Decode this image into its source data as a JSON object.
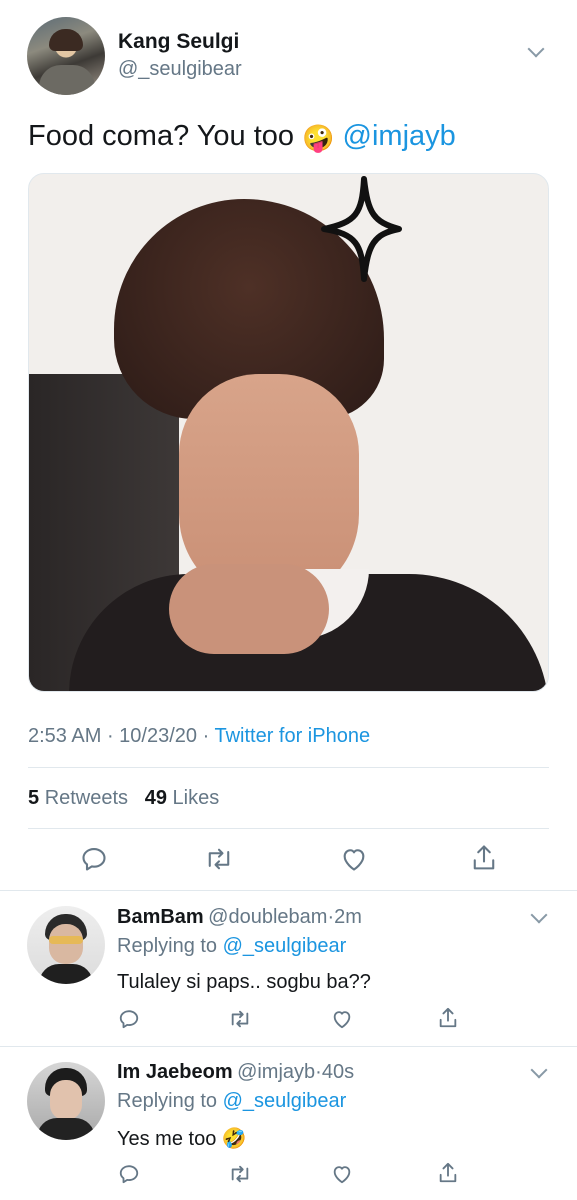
{
  "main_tweet": {
    "display_name": "Kang Seulgi",
    "handle": "@_seulgibear",
    "text": "Food coma? You too",
    "emoji": "🤪",
    "mention": "@imjayb",
    "time": "2:53 AM",
    "separator": " · ",
    "date": "10/23/20",
    "source": "Twitter for iPhone",
    "retweets_count": "5",
    "retweets_label": "Retweets",
    "likes_count": "49",
    "likes_label": "Likes"
  },
  "replies": [
    {
      "display_name": "BamBam",
      "handle": "@doublebam",
      "dot": "·",
      "time": "2m",
      "replying_prefix": "Replying to ",
      "replying_handle": "@_seulgibear",
      "text": "Tulaley si paps.. sogbu ba??"
    },
    {
      "display_name": "Im Jaebeom",
      "handle": "@imjayb",
      "dot": "·",
      "time": "40s",
      "replying_prefix": "Replying to ",
      "replying_handle": "@_seulgibear",
      "text": "Yes me too",
      "emoji": "🤣"
    }
  ],
  "icons": {
    "reply": "reply-icon",
    "retweet": "retweet-icon",
    "like": "heart-icon",
    "share": "share-icon",
    "menu": "chevron-down-icon"
  },
  "colors": {
    "link": "#1b95e0",
    "secondary_text": "#657786",
    "primary_text": "#14171a",
    "divider": "#e1e8ed"
  }
}
